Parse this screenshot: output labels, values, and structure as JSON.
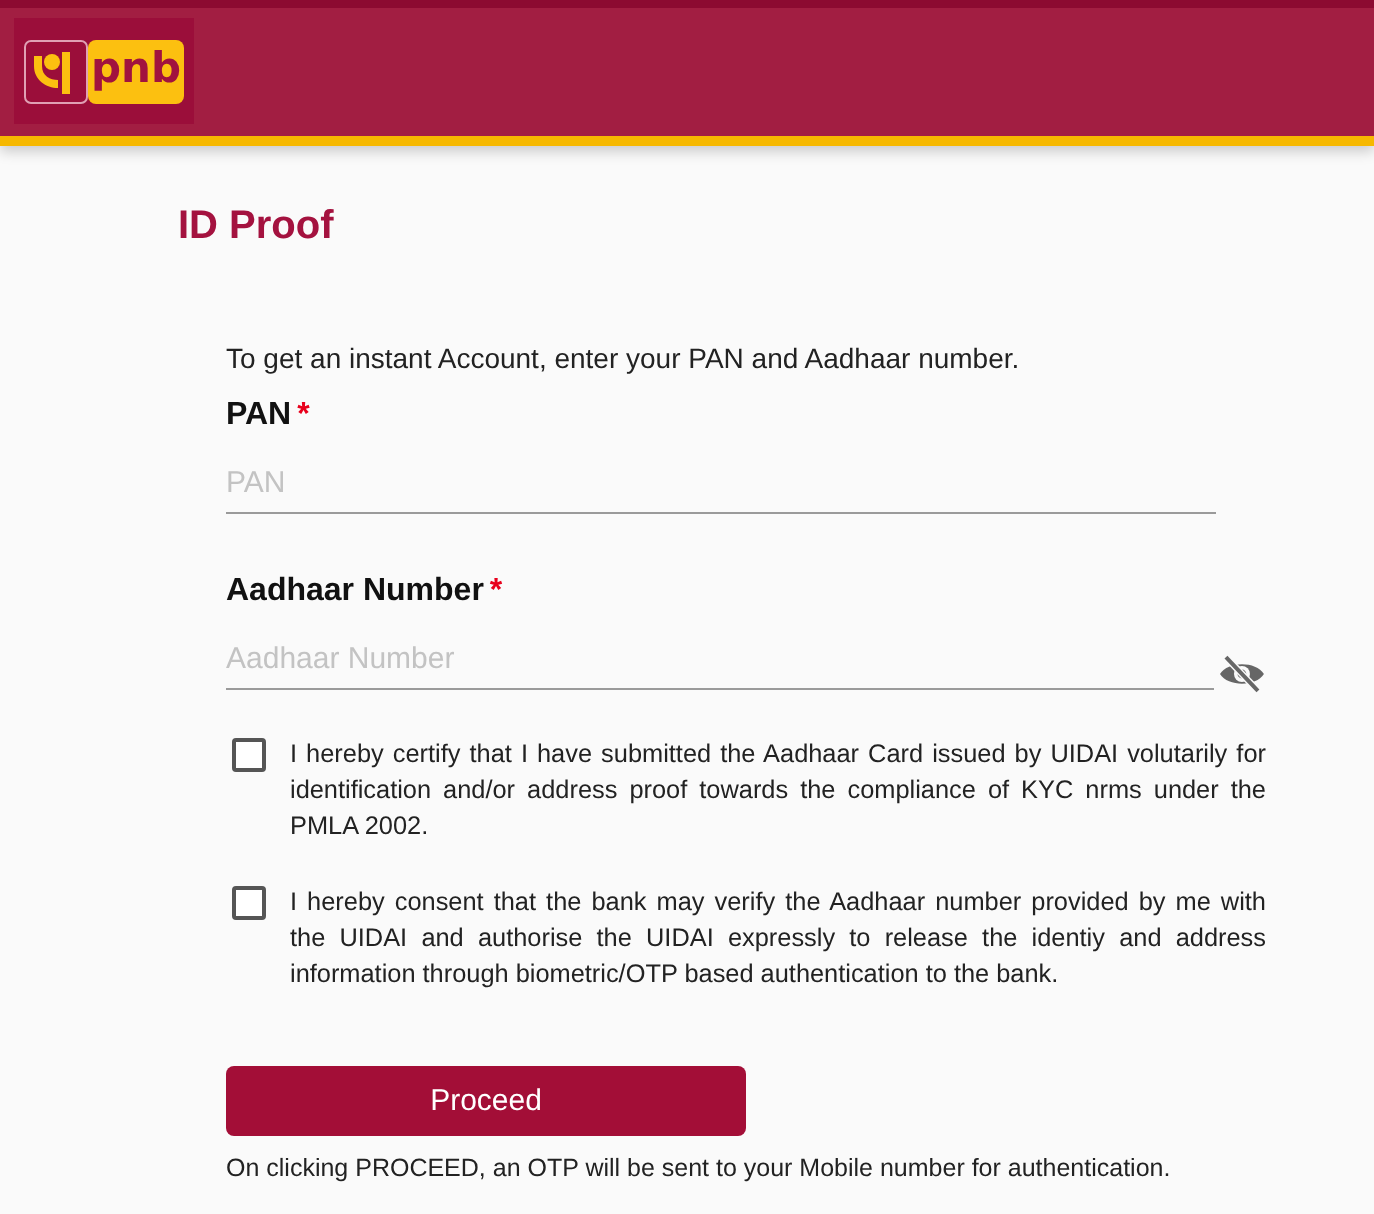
{
  "header": {
    "logo_text": "pnb"
  },
  "page_title": "ID Proof",
  "intro": "To get an instant Account, enter your PAN and Aadhaar number.",
  "fields": [
    {
      "kind": "text",
      "label": "PAN",
      "required_mark": "*",
      "placeholder": "PAN"
    },
    {
      "kind": "masked",
      "label": "Aadhaar Number",
      "required_mark": "*",
      "placeholder": "Aadhaar Number"
    }
  ],
  "consents": [
    {
      "checked": false,
      "text": "I hereby certify that I have submitted the Aadhaar Card issued by UIDAI volutarily for identification and/or address proof towards the compliance of KYC nrms under the PMLA 2002."
    },
    {
      "checked": false,
      "text": "I hereby consent that the bank may verify the Aadhaar number provided by me with the UIDAI and authorise the UIDAI expressly to release the identiy and address information through biometric/OTP based authentication to the bank."
    }
  ],
  "proceed_button": "Proceed",
  "note": "On clicking PROCEED, an OTP will be sent to your Mobile number for authentication."
}
